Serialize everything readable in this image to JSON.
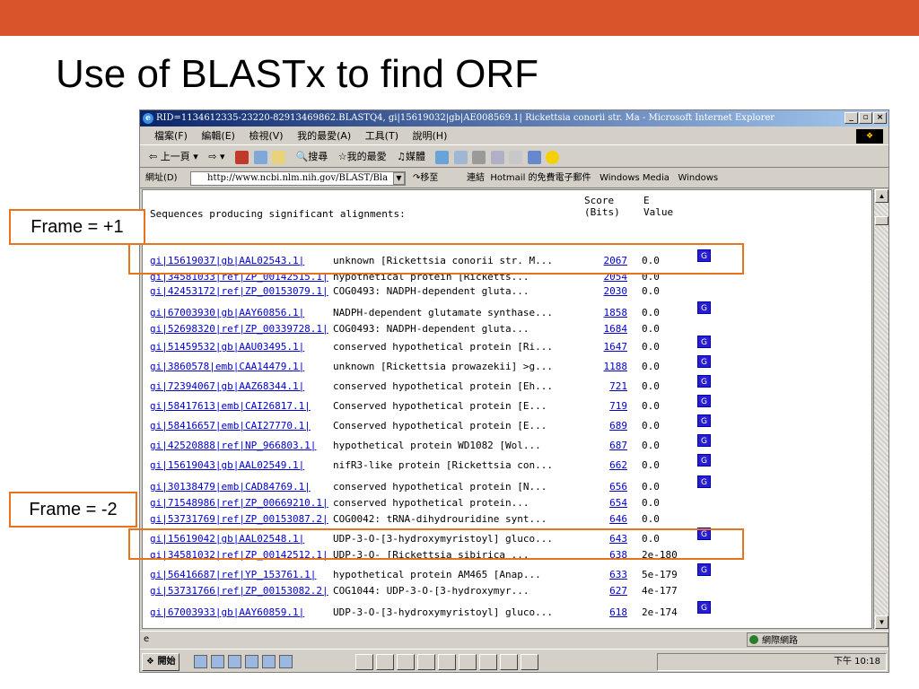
{
  "slide": {
    "title": "Use of BLASTx to find ORF"
  },
  "window": {
    "title": "RID=1134612335-23220-82913469862.BLASTQ4, gi|15619032|gb|AE008569.1| Rickettsia conorii str. Ma - Microsoft Internet Explorer",
    "buttons": [
      "_",
      "1",
      "X"
    ]
  },
  "menu": {
    "items": [
      "檔案(F)",
      "編輯(E)",
      "檢視(V)",
      "我的最愛(A)",
      "工具(T)",
      "說明(H)"
    ]
  },
  "toolbar": {
    "back": "上一頁",
    "search": "搜尋",
    "favorites": "我的最愛",
    "media": "媒體"
  },
  "address": {
    "label": "網址(D)",
    "url": "http://www.ncbi.nlm.nih.gov/BLAST/Bla",
    "go": "移至",
    "links_label": "連結",
    "links": [
      "Hotmail 的免費電子郵件",
      "Windows Media",
      "Windows"
    ]
  },
  "results": {
    "header_left": "Sequences producing significant alignments:",
    "header_score": "Score\n(Bits)",
    "header_e": "E\nValue",
    "rows": [
      {
        "acc": "gi|15619037|gb|AAL02543.1|",
        "desc": "unknown [Rickettsia conorii str. M...",
        "score": "2067",
        "e": "0.0",
        "g": "G"
      },
      {
        "acc": "gi|34581033|ref|ZP_00142515.1|",
        "desc": "hypothetical protein [Ricketts...",
        "score": "2054",
        "e": "0.0",
        "g": ""
      },
      {
        "acc": "gi|42453172|ref|ZP_00153079.1|",
        "desc": "COG0493: NADPH-dependent gluta...",
        "score": "2030",
        "e": "0.0",
        "g": ""
      },
      {
        "acc": "gi|67003930|gb|AAY60856.1|",
        "desc": "NADPH-dependent glutamate synthase...",
        "score": "1858",
        "e": "0.0",
        "g": "G"
      },
      {
        "acc": "gi|52698320|ref|ZP_00339728.1|",
        "desc": "COG0493: NADPH-dependent gluta...",
        "score": "1684",
        "e": "0.0",
        "g": ""
      },
      {
        "acc": "gi|51459532|gb|AAU03495.1|",
        "desc": "conserved hypothetical protein [Ri...",
        "score": "1647",
        "e": "0.0",
        "g": "G"
      },
      {
        "acc": "gi|3860578|emb|CAA14479.1|",
        "desc": "unknown [Rickettsia prowazekii] >g...",
        "score": "1188",
        "e": "0.0",
        "g": "G"
      },
      {
        "acc": "gi|72394067|gb|AAZ68344.1|",
        "desc": "conserved hypothetical protein [Eh...",
        "score": "721",
        "e": "0.0",
        "g": "G"
      },
      {
        "acc": "gi|58417613|emb|CAI26817.1|",
        "desc": "Conserved hypothetical protein [E...",
        "score": "719",
        "e": "0.0",
        "g": "G"
      },
      {
        "acc": "gi|58416657|emb|CAI27770.1|",
        "desc": "Conserved hypothetical protein [E...",
        "score": "689",
        "e": "0.0",
        "g": "G"
      },
      {
        "acc": "gi|42520888|ref|NP_966803.1|",
        "desc": "hypothetical protein WD1082 [Wol...",
        "score": "687",
        "e": "0.0",
        "g": "G"
      },
      {
        "acc": "gi|15619043|gb|AAL02549.1|",
        "desc": "nifR3-like protein [Rickettsia con...",
        "score": "662",
        "e": "0.0",
        "g": "G"
      },
      {
        "acc": "gi|30138479|emb|CAD84769.1|",
        "desc": "conserved hypothetical protein [N...",
        "score": "656",
        "e": "0.0",
        "g": "G"
      },
      {
        "acc": "gi|71548986|ref|ZP_00669210.1|",
        "desc": "conserved hypothetical protein...",
        "score": "654",
        "e": "0.0",
        "g": ""
      },
      {
        "acc": "gi|53731769|ref|ZP_00153087.2|",
        "desc": "COG0042: tRNA-dihydrouridine synt...",
        "score": "646",
        "e": "0.0",
        "g": ""
      },
      {
        "acc": "gi|15619042|gb|AAL02548.1|",
        "desc": "UDP-3-O-[3-hydroxymyristoyl] gluco...",
        "score": "643",
        "e": "0.0",
        "g": "G"
      },
      {
        "acc": "gi|34581032|ref|ZP_00142512.1|",
        "desc": "UDP-3-O- [Rickettsia sibirica ...",
        "score": "638",
        "e": "2e-180",
        "g": ""
      },
      {
        "acc": "gi|56416687|ref|YP_153761.1|",
        "desc": "hypothetical protein AM465 [Anap...",
        "score": "633",
        "e": "5e-179",
        "g": "G"
      },
      {
        "acc": "gi|53731766|ref|ZP_00153082.2|",
        "desc": "COG1044: UDP-3-O-[3-hydroxymyr...",
        "score": "627",
        "e": "4e-177",
        "g": ""
      },
      {
        "acc": "gi|67003933|gb|AAY60859.1|",
        "desc": "UDP-3-O-[3-hydroxymyristoyl] gluco...",
        "score": "618",
        "e": "2e-174",
        "g": "G"
      }
    ]
  },
  "status": {
    "zone": "網際網路"
  },
  "taskbar": {
    "start": "開始",
    "clock": "下午 10:18"
  },
  "callouts": {
    "frame_plus": "Frame = +1",
    "frame_minus": "Frame = -2"
  },
  "colors": {
    "accent": "#d9542b",
    "callout": "#e8731d",
    "link": "#0000cc",
    "badge": "#2a1ccf"
  }
}
